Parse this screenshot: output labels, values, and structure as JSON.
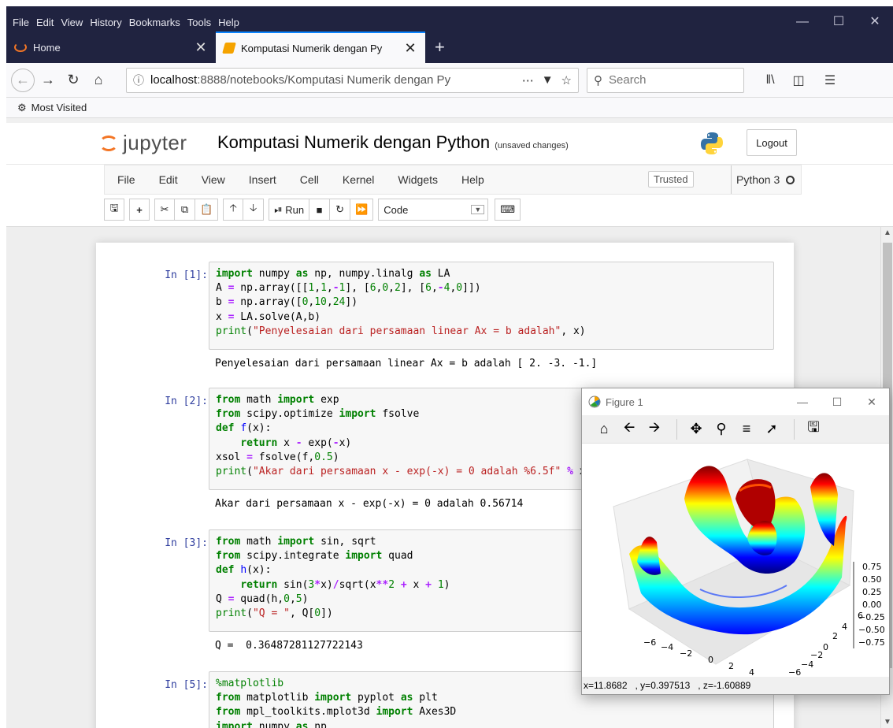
{
  "browser": {
    "menu": [
      "File",
      "Edit",
      "View",
      "History",
      "Bookmarks",
      "Tools",
      "Help"
    ],
    "tabs": [
      {
        "label": "Home"
      },
      {
        "label": "Komputasi Numerik dengan Py"
      }
    ],
    "url_host": "localhost",
    "url_rest": ":8888/notebooks/Komputasi Numerik dengan Py",
    "search_placeholder": "Search",
    "bookmark": "Most Visited"
  },
  "jupyter": {
    "logo_text": "jupyter",
    "notebook_title": "Komputasi Numerik dengan Python",
    "save_status": "(unsaved changes)",
    "logout": "Logout",
    "menu": [
      "File",
      "Edit",
      "View",
      "Insert",
      "Cell",
      "Kernel",
      "Widgets",
      "Help"
    ],
    "trusted": "Trusted",
    "kernel": "Python 3",
    "run_label": "Run",
    "cell_type": "Code"
  },
  "cells": [
    {
      "prompt": "In [1]:",
      "output": "Penyelesaian dari persamaan linear Ax = b adalah [ 2. -3. -1.]"
    },
    {
      "prompt": "In [2]:",
      "output": "Akar dari persamaan x - exp(-x) = 0 adalah 0.56714"
    },
    {
      "prompt": "In [3]:",
      "output": "Q =  0.36487281127722143"
    },
    {
      "prompt": "In [5]:",
      "output": ""
    }
  ],
  "figure": {
    "title": "Figure 1",
    "status_x": "x=11.8682",
    "status_y": ", y=0.397513",
    "status_z": ", z=-1.60889"
  },
  "chart_data": {
    "type": "surface3d",
    "title": "",
    "z_ticks": [
      "0.75",
      "0.50",
      "0.25",
      "0.00",
      "−0.25",
      "−0.50",
      "−0.75"
    ],
    "x_ticks": [
      "−6",
      "−4",
      "−2",
      "0",
      "2",
      "4"
    ],
    "y_ticks": [
      "6",
      "4",
      "2",
      "0",
      "−2",
      "−4",
      "−6"
    ],
    "colormap": "jet",
    "zlim": [
      -0.75,
      0.75
    ]
  }
}
